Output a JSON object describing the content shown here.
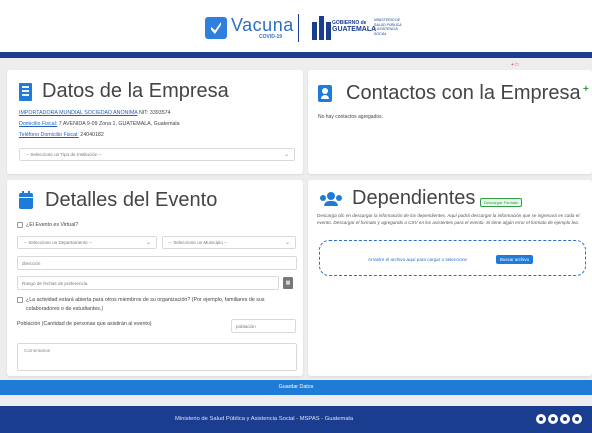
{
  "header": {
    "logo_vacuna_title": "Vacuna",
    "logo_vacuna_sub": "COVID-19",
    "gob_line1": "GOBIERNO de",
    "gob_line2": "GUATEMALA",
    "msp_text": "MINISTERIO DE SALUD PÚBLICA Y ASISTENCIA SOCIAL",
    "red_marker": "+ □"
  },
  "company": {
    "title": "Datos de la Empresa",
    "name": "IMPORTADORA MUNDIAL SOCIEDAD ANONIMA",
    "nit_label": "NIT:",
    "nit_value": "3393574",
    "address_label": "Domicilio Fiscal:",
    "address_value": "7 AVENIDA 9-09 Zona 1, GUATEMALA, Guatemala",
    "phone_label": "Teléfono Domicilio Fiscal:",
    "phone_value": "24040182",
    "institution_select": "-- Seleccione un Tipo de Institución --"
  },
  "contacts": {
    "title": "Contactos con la Empresa",
    "add_icon_label": "+",
    "empty_text": "No hay contactos agregados."
  },
  "event": {
    "title": "Detalles del Evento",
    "online_label": "¿El Evento es Virtual?",
    "department_select": "-- Seleccione un Departamento --",
    "municipality_select": "-- Seleccione un Municipio --",
    "address_placeholder": "dirección",
    "date_placeholder": "Rango de fechas de preferencia",
    "open_activity_label": "¿La actividad estará abierta para otros miembros de su organización? (Por ejemplo, familiares de sus colaboradores o de estudiantes.)",
    "population_label": "Población (Cantidad de personas que asistirán al evento)",
    "population_placeholder": "población",
    "comments_placeholder": "Comentarios"
  },
  "dependents": {
    "title": "Dependientes",
    "add_label": "Descargar Formato",
    "description": "Descarga clic en descargar la información de los dependientes. Aquí podrá descargar la información que se ingresará en cada el evento. Descargar el formato y agregando a CSV en los asistentes para el evento. Si tiene algún error el formato de ejemplo lea.",
    "drop_text": "Arrastre el archivo aquí para cargar o seleccione",
    "drop_button": "Buscar archivo"
  },
  "footer": {
    "save_label": "Guardar Datos",
    "ministry_text": "Ministerio de Salud Pública y Asistencia Social - MSPAS - Guatemala"
  },
  "icons": {
    "company": "building-icon",
    "contacts": "contact-card-icon",
    "event": "calendar-icon",
    "dependents": "users-icon",
    "date": "calendar-small-icon"
  },
  "colors": {
    "primary": "#1f7bd8",
    "navy": "#1a3d8f",
    "success": "#2ea043",
    "marker": "#e0354a"
  }
}
